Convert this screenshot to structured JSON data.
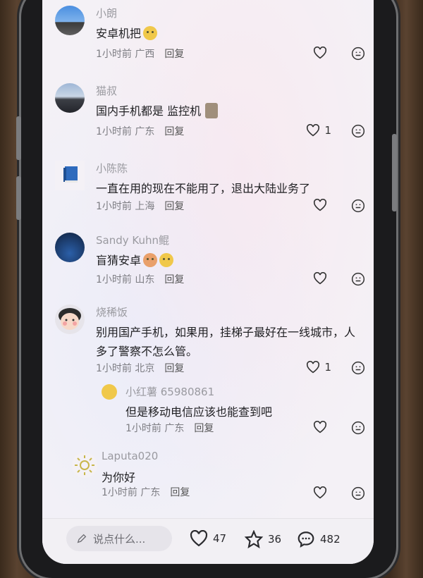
{
  "comments": [
    {
      "name": "小朗",
      "text": "安卓机把",
      "time": "1小时前",
      "location": "广西",
      "reply": "回复",
      "likes": ""
    },
    {
      "name": "猫叔",
      "text": "国内手机都是 监控机",
      "time": "1小时前",
      "location": "广东",
      "reply": "回复",
      "likes": "1"
    },
    {
      "name": "小陈陈",
      "text": "一直在用的现在不能用了，退出大陆业务了",
      "time": "1小时前",
      "location": "上海",
      "reply": "回复",
      "likes": ""
    },
    {
      "name": "Sandy Kuhn鲲",
      "text": "盲猜安卓",
      "time": "1小时前",
      "location": "山东",
      "reply": "回复",
      "likes": ""
    },
    {
      "name": "烧稀饭",
      "text": "别用国产手机，如果用，挂梯子最好在一线城市，人多了警察不怎么管。",
      "time": "1小时前",
      "location": "北京",
      "reply": "回复",
      "likes": "1"
    },
    {
      "name": "小红薯 65980861",
      "text": "但是移动电信应该也能查到吧",
      "time": "1小时前",
      "location": "广东",
      "reply": "回复",
      "likes": ""
    },
    {
      "name": "Laputa020",
      "text": "为你好",
      "time": "1小时前",
      "location": "广东",
      "reply": "回复",
      "likes": ""
    }
  ],
  "bottom_bar": {
    "input_placeholder": "说点什么...",
    "likes": "47",
    "favorites": "36",
    "comments": "482"
  },
  "icons": {
    "like": "heart-outline-icon",
    "dislike": "dislike-face-icon",
    "favorite": "star-outline-icon",
    "comment": "chat-bubble-icon",
    "edit": "pencil-icon"
  }
}
